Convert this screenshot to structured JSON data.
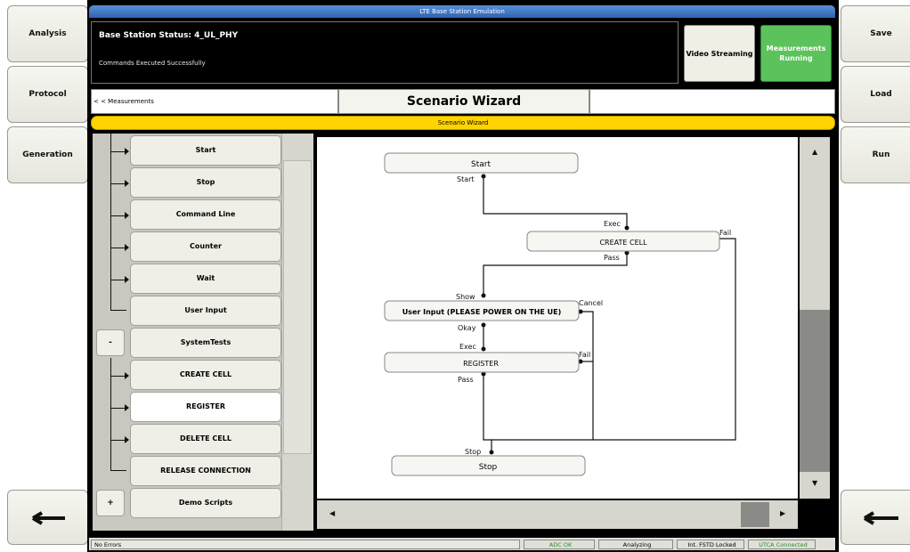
{
  "window": {
    "title": "LTE Base Station Emulation"
  },
  "left_nav": {
    "analysis": "Analysis",
    "protocol": "Protocol",
    "generation": "Generation"
  },
  "right_nav": {
    "save": "Save",
    "load": "Load",
    "run": "Run"
  },
  "status_panel": {
    "title": "Base Station Status: 4_UL_PHY",
    "message": "Commands Executed Successfully"
  },
  "buttons": {
    "video_streaming": "Video Streaming",
    "measurements_running": "Measurements Running"
  },
  "nav": {
    "back": "< < Measurements",
    "title": "Scenario Wizard",
    "subtitle": "Scenario Wizard"
  },
  "tree": {
    "items": [
      "Start",
      "Stop",
      "Command Line",
      "Counter",
      "Wait",
      "User Input",
      "SystemTests",
      "CREATE CELL",
      "REGISTER",
      "DELETE CELL",
      "RELEASE CONNECTION",
      "Demo Scripts"
    ],
    "systemtests_toggle": "-",
    "demo_toggle": "+",
    "selected": "REGISTER"
  },
  "flow": {
    "nodes": {
      "start": "Start",
      "create_cell": "CREATE CELL",
      "user_input": "User Input (PLEASE POWER ON THE UE)",
      "register": "REGISTER",
      "stop": "Stop"
    },
    "ports": {
      "start_out": "Start",
      "create_exec": "Exec",
      "create_fail": "Fail",
      "create_pass": "Pass",
      "ui_show": "Show",
      "ui_cancel": "Cancel",
      "ui_okay": "Okay",
      "reg_exec": "Exec",
      "reg_fail": "Fail",
      "reg_pass": "Pass",
      "stop_in": "Stop"
    }
  },
  "statusbar": {
    "errors": "No Errors",
    "adc": "ADC OK",
    "analyzing": "Analyzing",
    "fstd": "Int. FSTD Locked",
    "utca": "UTCA Connected"
  },
  "colors": {
    "measurements_green": "#5cc25c",
    "title_blue": "#2f63b2",
    "wizard_yellow": "#ffd400"
  }
}
